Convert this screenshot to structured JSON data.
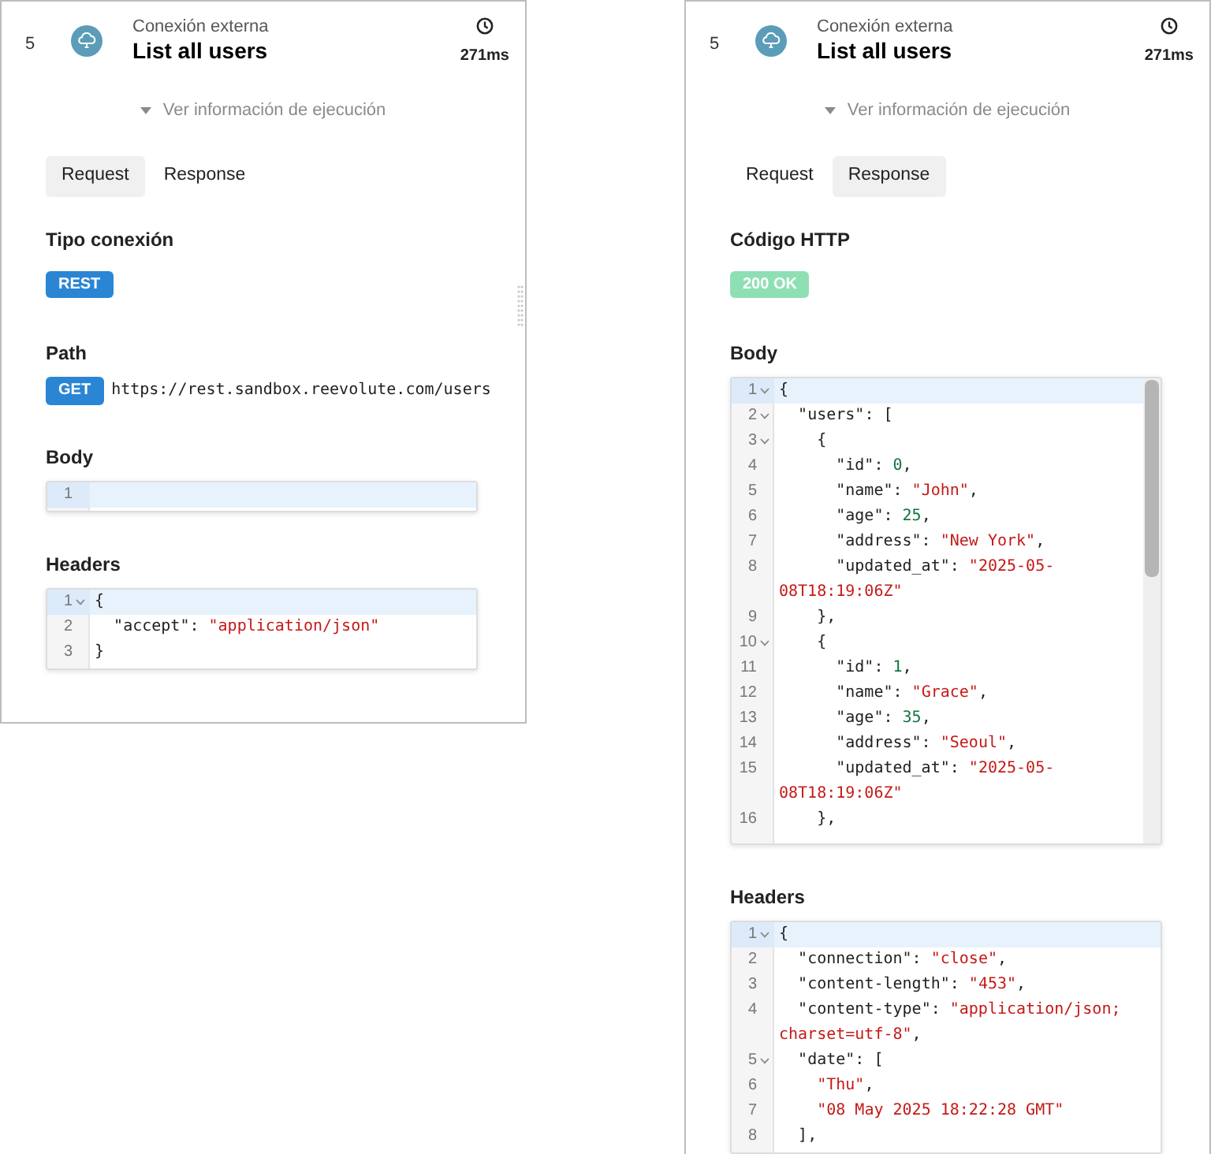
{
  "panels": [
    {
      "step": "5",
      "subtitle": "Conexión externa",
      "title": "List all users",
      "duration": "271ms",
      "info_toggle": "Ver información de ejecución",
      "resize_handle": true,
      "tabs": [
        {
          "label": "Request",
          "selected": true
        },
        {
          "label": "Response",
          "selected": false
        }
      ],
      "sections": [
        {
          "kind": "badge",
          "label": "Tipo conexión",
          "badge": "REST",
          "color": "#2a86d4"
        },
        {
          "kind": "path",
          "label": "Path",
          "method": "GET",
          "color": "#2a86d4",
          "url": "https://rest.sandbox.reevolute.com/users"
        },
        {
          "kind": "code",
          "label": "Body",
          "scrollbar": false,
          "lines": [
            {
              "number": "1",
              "foldable": false,
              "active": true
            }
          ]
        },
        {
          "kind": "code",
          "label": "Headers",
          "scrollbar": false,
          "lines": [
            {
              "number": "1",
              "foldable": true,
              "active": true,
              "tokens": [
                {
                  "kind": "punct",
                  "text": "{"
                }
              ]
            },
            {
              "number": "2",
              "foldable": false,
              "active": false,
              "tokens": [
                {
                  "kind": "key",
                  "text": "  \"accept\": "
                },
                {
                  "kind": "string",
                  "text": "\"application/json\""
                }
              ]
            },
            {
              "number": "3",
              "foldable": false,
              "active": false,
              "tokens": [
                {
                  "kind": "punct",
                  "text": "}"
                }
              ]
            }
          ]
        }
      ]
    },
    {
      "step": "5",
      "subtitle": "Conexión externa",
      "title": "List all users",
      "duration": "271ms",
      "info_toggle": "Ver información de ejecución",
      "resize_handle": false,
      "tabs": [
        {
          "label": "Request",
          "selected": false
        },
        {
          "label": "Response",
          "selected": true
        }
      ],
      "sections": [
        {
          "kind": "badge",
          "label": "Código HTTP",
          "badge": "200 OK",
          "color": "#8ee0b4"
        },
        {
          "kind": "code",
          "label": "Body",
          "scrollbar": true,
          "lines": [
            {
              "number": "1",
              "foldable": true,
              "active": true,
              "tokens": [
                {
                  "kind": "punct",
                  "text": "{"
                }
              ]
            },
            {
              "number": "2",
              "foldable": true,
              "active": false,
              "tokens": [
                {
                  "kind": "key",
                  "text": "  \"users\": ["
                }
              ]
            },
            {
              "number": "3",
              "foldable": true,
              "active": false,
              "tokens": [
                {
                  "kind": "punct",
                  "text": "    {"
                }
              ]
            },
            {
              "number": "4",
              "foldable": false,
              "active": false,
              "tokens": [
                {
                  "kind": "key",
                  "text": "      \"id\": "
                },
                {
                  "kind": "number",
                  "text": "0"
                },
                {
                  "kind": "punct",
                  "text": ","
                }
              ]
            },
            {
              "number": "5",
              "foldable": false,
              "active": false,
              "tokens": [
                {
                  "kind": "key",
                  "text": "      \"name\": "
                },
                {
                  "kind": "string",
                  "text": "\"John\""
                },
                {
                  "kind": "punct",
                  "text": ","
                }
              ]
            },
            {
              "number": "6",
              "foldable": false,
              "active": false,
              "tokens": [
                {
                  "kind": "key",
                  "text": "      \"age\": "
                },
                {
                  "kind": "number",
                  "text": "25"
                },
                {
                  "kind": "punct",
                  "text": ","
                }
              ]
            },
            {
              "number": "7",
              "foldable": false,
              "active": false,
              "tokens": [
                {
                  "kind": "key",
                  "text": "      \"address\": "
                },
                {
                  "kind": "string",
                  "text": "\"New York\""
                },
                {
                  "kind": "punct",
                  "text": ","
                }
              ]
            },
            {
              "number": "8",
              "foldable": false,
              "active": false,
              "tokens": [
                {
                  "kind": "key",
                  "text": "      \"updated_at\": "
                },
                {
                  "kind": "string",
                  "text": "\"2025-05-08T18:19:06Z\""
                }
              ]
            },
            {
              "number": "9",
              "foldable": false,
              "active": false,
              "tokens": [
                {
                  "kind": "punct",
                  "text": "    },"
                }
              ]
            },
            {
              "number": "10",
              "foldable": true,
              "active": false,
              "tokens": [
                {
                  "kind": "punct",
                  "text": "    {"
                }
              ]
            },
            {
              "number": "11",
              "foldable": false,
              "active": false,
              "tokens": [
                {
                  "kind": "key",
                  "text": "      \"id\": "
                },
                {
                  "kind": "number",
                  "text": "1"
                },
                {
                  "kind": "punct",
                  "text": ","
                }
              ]
            },
            {
              "number": "12",
              "foldable": false,
              "active": false,
              "tokens": [
                {
                  "kind": "key",
                  "text": "      \"name\": "
                },
                {
                  "kind": "string",
                  "text": "\"Grace\""
                },
                {
                  "kind": "punct",
                  "text": ","
                }
              ]
            },
            {
              "number": "13",
              "foldable": false,
              "active": false,
              "tokens": [
                {
                  "kind": "key",
                  "text": "      \"age\": "
                },
                {
                  "kind": "number",
                  "text": "35"
                },
                {
                  "kind": "punct",
                  "text": ","
                }
              ]
            },
            {
              "number": "14",
              "foldable": false,
              "active": false,
              "tokens": [
                {
                  "kind": "key",
                  "text": "      \"address\": "
                },
                {
                  "kind": "string",
                  "text": "\"Seoul\""
                },
                {
                  "kind": "punct",
                  "text": ","
                }
              ]
            },
            {
              "number": "15",
              "foldable": false,
              "active": false,
              "tokens": [
                {
                  "kind": "key",
                  "text": "      \"updated_at\": "
                },
                {
                  "kind": "string",
                  "text": "\"2025-05-08T18:19:06Z\""
                }
              ]
            },
            {
              "number": "16",
              "foldable": false,
              "active": false,
              "tokens": [
                {
                  "kind": "punct",
                  "text": "    },"
                }
              ]
            }
          ]
        },
        {
          "kind": "code",
          "label": "Headers",
          "scrollbar": false,
          "lines": [
            {
              "number": "1",
              "foldable": true,
              "active": true,
              "tokens": [
                {
                  "kind": "punct",
                  "text": "{"
                }
              ]
            },
            {
              "number": "2",
              "foldable": false,
              "active": false,
              "tokens": [
                {
                  "kind": "key",
                  "text": "  \"connection\": "
                },
                {
                  "kind": "string",
                  "text": "\"close\""
                },
                {
                  "kind": "punct",
                  "text": ","
                }
              ]
            },
            {
              "number": "3",
              "foldable": false,
              "active": false,
              "tokens": [
                {
                  "kind": "key",
                  "text": "  \"content-length\": "
                },
                {
                  "kind": "string",
                  "text": "\"453\""
                },
                {
                  "kind": "punct",
                  "text": ","
                }
              ]
            },
            {
              "number": "4",
              "foldable": false,
              "active": false,
              "tokens": [
                {
                  "kind": "key",
                  "text": "  \"content-type\": "
                },
                {
                  "kind": "string",
                  "text": "\"application/json; charset=utf-8\""
                },
                {
                  "kind": "punct",
                  "text": ","
                }
              ]
            },
            {
              "number": "5",
              "foldable": true,
              "active": false,
              "tokens": [
                {
                  "kind": "key",
                  "text": "  \"date\": ["
                }
              ]
            },
            {
              "number": "6",
              "foldable": false,
              "active": false,
              "tokens": [
                {
                  "kind": "string",
                  "text": "    \"Thu\""
                },
                {
                  "kind": "punct",
                  "text": ","
                }
              ]
            },
            {
              "number": "7",
              "foldable": false,
              "active": false,
              "tokens": [
                {
                  "kind": "string",
                  "text": "    \"08 May 2025 18:22:28 GMT\""
                }
              ]
            },
            {
              "number": "8",
              "foldable": false,
              "active": false,
              "tokens": [
                {
                  "kind": "punct",
                  "text": "  ],"
                }
              ]
            }
          ]
        }
      ]
    }
  ]
}
